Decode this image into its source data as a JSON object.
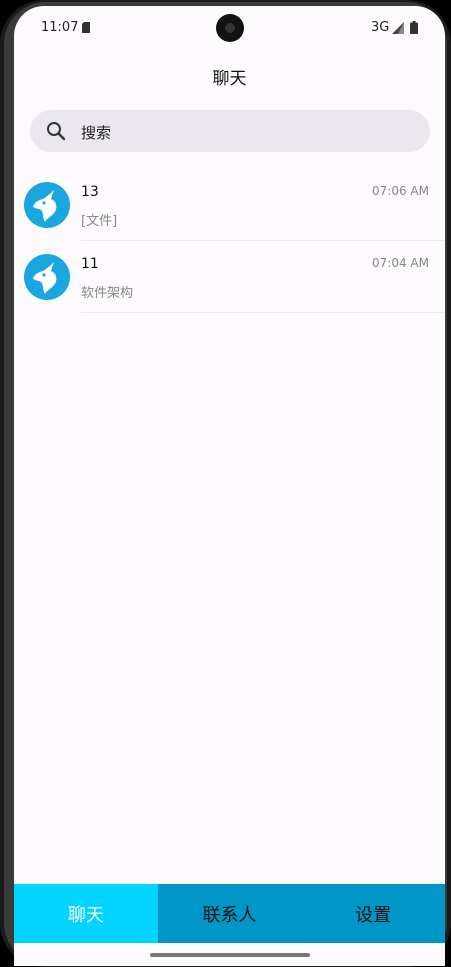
{
  "status_bar": {
    "time": "11:07",
    "network": "3G"
  },
  "header": {
    "title": "聊天"
  },
  "search": {
    "placeholder": "搜索"
  },
  "chats": [
    {
      "name": "13",
      "time": "07:06 AM",
      "preview": "[文件]"
    },
    {
      "name": "11",
      "time": "07:04 AM",
      "preview": "软件架构"
    }
  ],
  "tabs": [
    {
      "label": "聊天",
      "active": true
    },
    {
      "label": "联系人",
      "active": false
    },
    {
      "label": "设置",
      "active": false
    }
  ],
  "colors": {
    "tab_active": "#00d4ff",
    "tab_inactive": "#0096c7",
    "avatar": "#1aa6df",
    "search_bg": "#ebe7ef"
  }
}
